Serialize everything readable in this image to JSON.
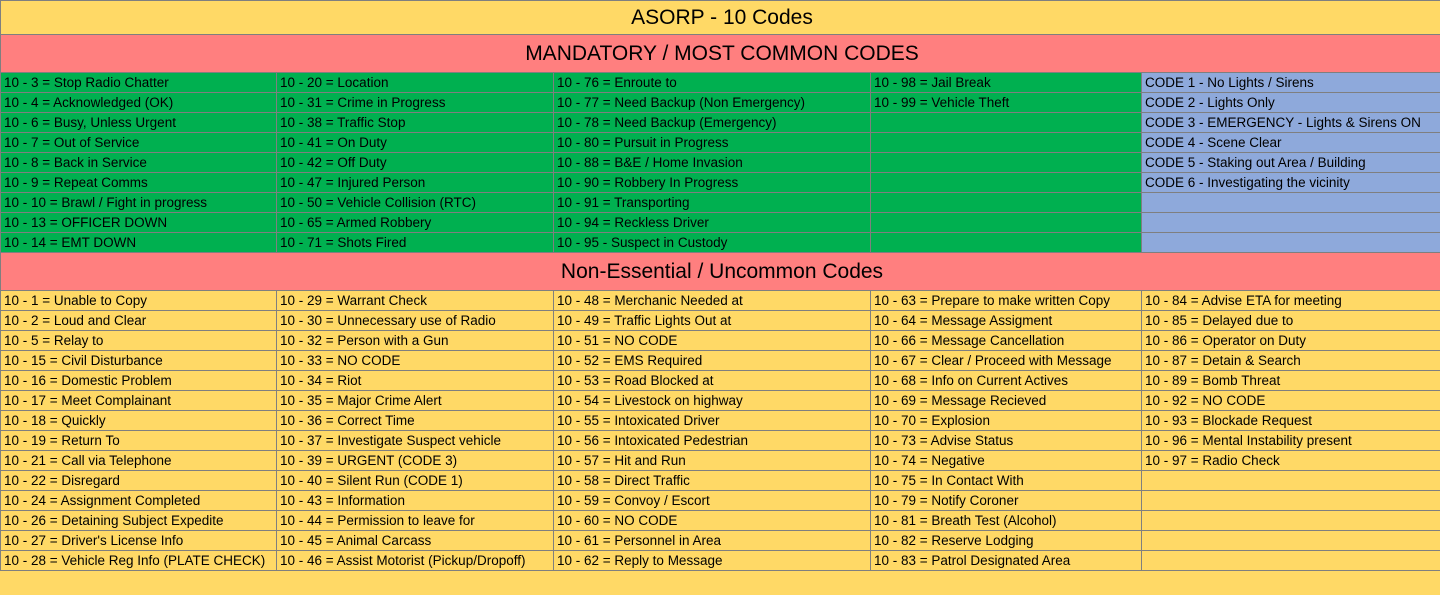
{
  "title": "ASORP - 10 Codes",
  "mandatory": {
    "heading": "MANDATORY / MOST COMMON CODES",
    "columns": [
      [
        "10 - 3 = Stop Radio Chatter",
        "10 - 4 = Acknowledged (OK)",
        "10 - 6 = Busy, Unless Urgent",
        "10 - 7 = Out of Service",
        "10 - 8 = Back in Service",
        "10 - 9 = Repeat Comms",
        "10 - 10 = Brawl / Fight in progress",
        "10 - 13 = OFFICER DOWN",
        "10 - 14 = EMT DOWN"
      ],
      [
        "10 - 20 = Location",
        "10 - 31 = Crime in Progress",
        "10 - 38 = Traffic Stop",
        "10 - 41 = On Duty",
        "10 - 42 = Off Duty",
        "10 - 47 = Injured Person",
        "10 - 50 = Vehicle Collision (RTC)",
        "10 - 65 = Armed Robbery",
        "10 - 71 = Shots Fired"
      ],
      [
        "10 - 76 = Enroute to",
        "10 - 77 = Need Backup (Non Emergency)",
        "10 - 78 = Need Backup (Emergency)",
        "10 - 80 = Pursuit in Progress",
        "10 - 88 = B&E / Home Invasion",
        "10 - 90 = Robbery In Progress",
        "10 - 91 = Transporting",
        "10 - 94 = Reckless Driver",
        "10 - 95 - Suspect in Custody"
      ],
      [
        "10 - 98 = Jail Break",
        "10 - 99 = Vehicle Theft",
        "",
        "",
        "",
        "",
        "",
        "",
        ""
      ],
      [
        "CODE 1 - No Lights / Sirens",
        "CODE 2 - Lights Only",
        "CODE 3 - EMERGENCY - Lights & Sirens ON",
        "CODE 4 - Scene Clear",
        "CODE 5 - Staking out Area / Building",
        "CODE 6 - Investigating the vicinity",
        "",
        "",
        ""
      ]
    ]
  },
  "uncommon": {
    "heading": "Non-Essential / Uncommon Codes",
    "columns": [
      [
        "10 - 1 = Unable to Copy",
        "10 - 2 = Loud and Clear",
        "10 - 5 = Relay to",
        "10 - 15 = Civil Disturbance",
        "10 - 16 = Domestic Problem",
        "10 - 17 = Meet Complainant",
        "10 - 18 = Quickly",
        "10 - 19 = Return To",
        "10 - 21 = Call via Telephone",
        "10 - 22 = Disregard",
        "10 - 24 = Assignment Completed",
        "10 - 26 = Detaining Subject Expedite",
        "10 - 27 = Driver's License Info",
        "10 - 28 = Vehicle Reg Info (PLATE CHECK)"
      ],
      [
        "10 - 29 = Warrant Check",
        "10 - 30 = Unnecessary use of Radio",
        "10 - 32 = Person with a Gun",
        "10 - 33 = NO CODE",
        "10 - 34 = Riot",
        "10 - 35 = Major Crime Alert",
        "10 - 36 = Correct Time",
        "10 - 37 = Investigate Suspect vehicle",
        "10 - 39 = URGENT (CODE 3)",
        "10 - 40 = Silent Run (CODE 1)",
        "10 - 43 = Information",
        "10 - 44 = Permission to leave for",
        "10 - 45 = Animal Carcass",
        "10 - 46 = Assist Motorist (Pickup/Dropoff)"
      ],
      [
        "10 - 48 = Merchanic Needed at",
        "10 - 49 = Traffic Lights Out at",
        "10 - 51 = NO CODE",
        "10 - 52 = EMS Required",
        "10 - 53 = Road Blocked at",
        "10 - 54 = Livestock on highway",
        "10 - 55 = Intoxicated Driver",
        "10 - 56 = Intoxicated Pedestrian",
        "10 - 57 = Hit and Run",
        "10 - 58 = Direct Traffic",
        "10 - 59 = Convoy / Escort",
        "10 - 60 = NO CODE",
        "10 - 61 = Personnel in Area",
        "10 - 62 = Reply to Message"
      ],
      [
        "10 - 63 = Prepare to make written Copy",
        "10 - 64 = Message Assigment",
        "10 - 66 = Message Cancellation",
        "10 - 67 = Clear / Proceed with Message",
        "10 - 68 = Info on Current Actives",
        "10 - 69 = Message Recieved",
        "10 - 70 = Explosion",
        "10 - 73 = Advise Status",
        "10 - 74 = Negative",
        "10 - 75 = In Contact With",
        "10 - 79 = Notify Coroner",
        "10 - 81 = Breath Test (Alcohol)",
        "10 - 82 = Reserve Lodging",
        "10 - 83 = Patrol Designated Area"
      ],
      [
        "10 - 84 = Advise ETA for meeting",
        "10 - 85 = Delayed due to",
        "10 - 86 = Operator on Duty",
        "10 - 87 = Detain & Search",
        "10 - 89 = Bomb Threat",
        "10 - 92 = NO CODE",
        "10 - 93 = Blockade Request",
        "10 - 96 = Mental Instability present",
        "10 - 97 = Radio Check",
        "",
        "",
        "",
        "",
        ""
      ]
    ]
  },
  "colors": {
    "title_bg": "#ffd966",
    "section_bg": "#ff7f7f",
    "mandatory_bg": "#00b050",
    "codes_bg": "#8ea9db",
    "uncommon_bg": "#ffd966"
  }
}
